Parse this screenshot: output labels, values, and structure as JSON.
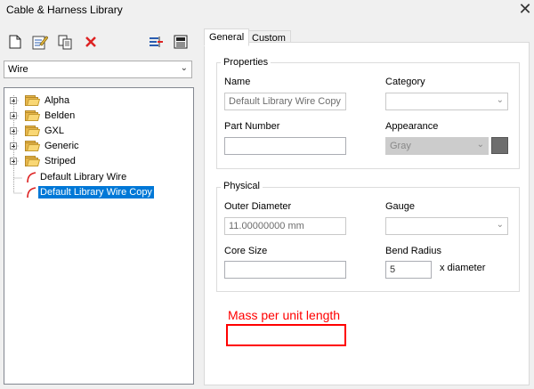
{
  "window": {
    "title": "Cable & Harness Library",
    "close_glyph": "✕"
  },
  "toolbar": {
    "buttons": [
      {
        "name": "new-icon"
      },
      {
        "name": "edit-icon"
      },
      {
        "name": "copy-icon"
      },
      {
        "name": "delete-icon"
      },
      {
        "name": "import-icon"
      },
      {
        "name": "library-icon"
      }
    ]
  },
  "filter": {
    "selected": "Wire"
  },
  "tree": {
    "folders": [
      {
        "label": "Alpha"
      },
      {
        "label": "Belden"
      },
      {
        "label": "GXL"
      },
      {
        "label": "Generic"
      },
      {
        "label": "Striped"
      }
    ],
    "items": [
      {
        "label": "Default Library Wire",
        "selected": false
      },
      {
        "label": "Default Library Wire Copy",
        "selected": true
      }
    ]
  },
  "tabs": {
    "general": "General",
    "custom": "Custom"
  },
  "properties": {
    "group_label": "Properties",
    "name_label": "Name",
    "name_value": "Default Library Wire Copy",
    "category_label": "Category",
    "category_value": "",
    "part_number_label": "Part Number",
    "part_number_value": "",
    "appearance_label": "Appearance",
    "appearance_value": "Gray",
    "appearance_color": "#6e6e6e"
  },
  "physical": {
    "group_label": "Physical",
    "outer_diameter_label": "Outer Diameter",
    "outer_diameter_value": "11.00000000 mm",
    "gauge_label": "Gauge",
    "gauge_value": "",
    "core_size_label": "Core Size",
    "core_size_value": "",
    "bend_radius_label": "Bend Radius",
    "bend_radius_value": "5",
    "bend_radius_unit": "x diameter"
  },
  "annotation": {
    "label": "Mass per unit length",
    "color": "#ff0000"
  }
}
